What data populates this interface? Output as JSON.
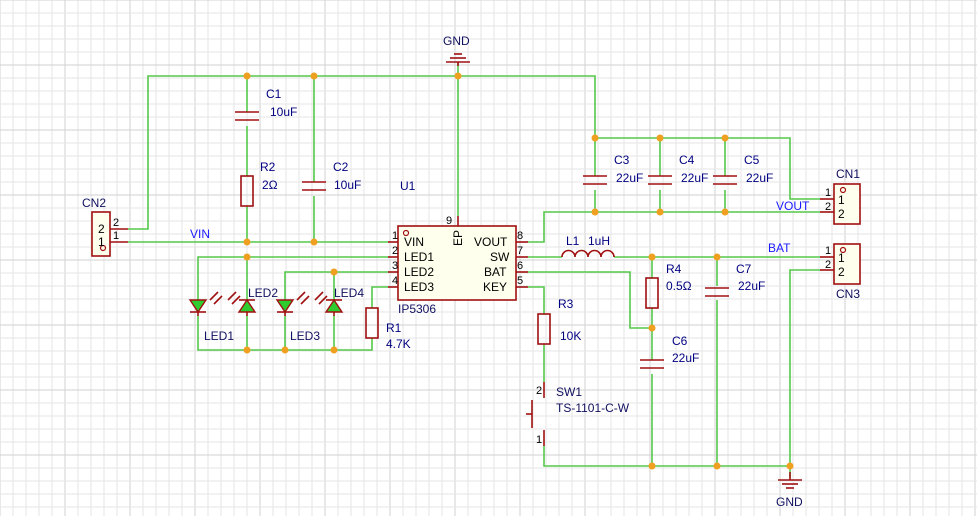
{
  "colors": {
    "wire": "#55c84a",
    "component": "#a01010",
    "junction": "#f0a020",
    "net_label": "#1a1aff",
    "ref_text": "#000080",
    "led": "#2ecc2e"
  },
  "power": {
    "gnd_top": "GND",
    "gnd_bottom": "GND"
  },
  "nets": {
    "vin": "VIN",
    "vout": "VOUT",
    "bat": "BAT"
  },
  "ic": {
    "ref": "U1",
    "part": "IP5306",
    "pins_left": [
      {
        "num": "1",
        "name": "VIN"
      },
      {
        "num": "2",
        "name": "LED1"
      },
      {
        "num": "3",
        "name": "LED2"
      },
      {
        "num": "4",
        "name": "LED3"
      }
    ],
    "pins_right": [
      {
        "num": "8",
        "name": "VOUT"
      },
      {
        "num": "7",
        "name": "SW"
      },
      {
        "num": "6",
        "name": "BAT"
      },
      {
        "num": "5",
        "name": "KEY"
      }
    ],
    "pin_top": {
      "num": "9",
      "name": "EP"
    }
  },
  "capacitors": [
    {
      "ref": "C1",
      "value": "10uF"
    },
    {
      "ref": "C2",
      "value": "10uF"
    },
    {
      "ref": "C3",
      "value": "22uF"
    },
    {
      "ref": "C4",
      "value": "22uF"
    },
    {
      "ref": "C5",
      "value": "22uF"
    },
    {
      "ref": "C6",
      "value": "22uF"
    },
    {
      "ref": "C7",
      "value": "22uF"
    }
  ],
  "resistors": [
    {
      "ref": "R1",
      "value": "4.7K"
    },
    {
      "ref": "R2",
      "value": "2Ω"
    },
    {
      "ref": "R3",
      "value": "10K"
    },
    {
      "ref": "R4",
      "value": "0.5Ω"
    }
  ],
  "inductor": {
    "ref": "L1",
    "value": "1uH"
  },
  "switch": {
    "ref": "SW1",
    "part": "TS-1101-C-W",
    "pin1": "1",
    "pin2": "2"
  },
  "leds": [
    "LED1",
    "LED2",
    "LED3",
    "LED4"
  ],
  "connectors": [
    {
      "ref": "CN1",
      "pins": [
        "1",
        "2"
      ],
      "outer_pins": [
        "1",
        "2"
      ]
    },
    {
      "ref": "CN2",
      "pins": [
        "2",
        "1"
      ],
      "outer_pins": [
        "2",
        "1"
      ]
    },
    {
      "ref": "CN3",
      "pins": [
        "1",
        "2"
      ],
      "outer_pins": [
        "1",
        "2"
      ]
    }
  ]
}
